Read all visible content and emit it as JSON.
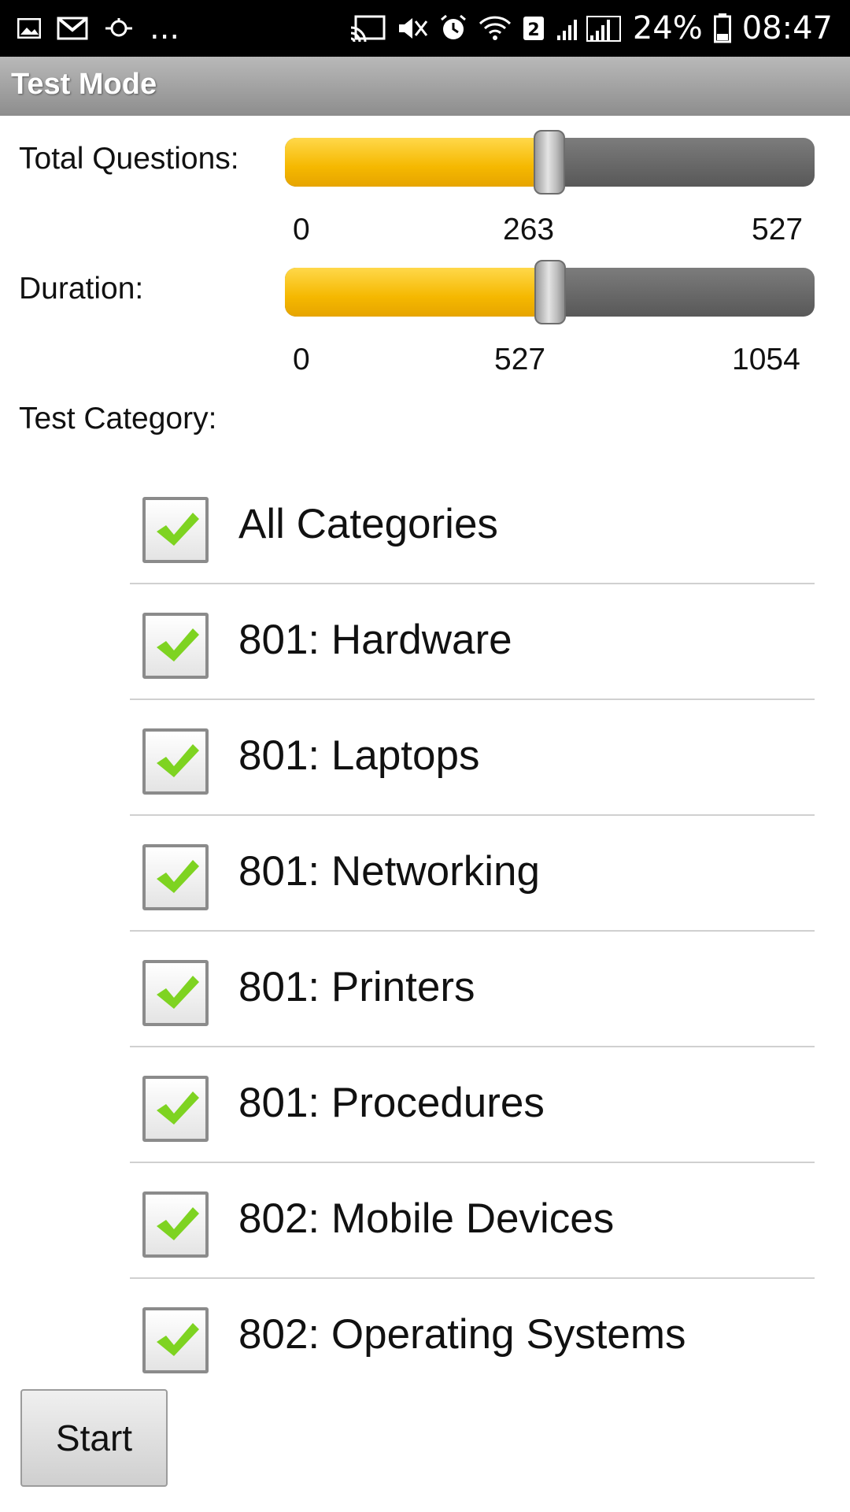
{
  "status_bar": {
    "left_icons": [
      "gallery-icon",
      "gmail-icon",
      "sync-icon"
    ],
    "overflow": "...",
    "right_icons": [
      "cast-icon",
      "mute-icon",
      "alarm-icon",
      "wifi-icon",
      "sim-icon",
      "signal-icon"
    ],
    "sim_label": "2",
    "battery": "24%",
    "time": "08:47"
  },
  "action_bar": {
    "title": "Test Mode"
  },
  "total_questions": {
    "label": "Total Questions:",
    "min": "0",
    "mid": "263",
    "max": "527",
    "value": 263,
    "range_max": 527
  },
  "duration": {
    "label": "Duration:",
    "min": "0",
    "mid": "527",
    "max": "1054",
    "value": 527,
    "range_max": 1054
  },
  "category": {
    "label": "Test Category:",
    "items": [
      {
        "label": "All Categories",
        "checked": true
      },
      {
        "label": "801: Hardware",
        "checked": true
      },
      {
        "label": "801: Laptops",
        "checked": true
      },
      {
        "label": "801: Networking",
        "checked": true
      },
      {
        "label": "801: Printers",
        "checked": true
      },
      {
        "label": "801: Procedures",
        "checked": true
      },
      {
        "label": "802: Mobile Devices",
        "checked": true
      },
      {
        "label": "802: Operating Systems",
        "checked": true
      }
    ]
  },
  "actions": {
    "start_label": "Start"
  },
  "colors": {
    "slider_fill": "#f5b800",
    "check": "#7ed321",
    "action_bar": "#9e9e9e"
  }
}
